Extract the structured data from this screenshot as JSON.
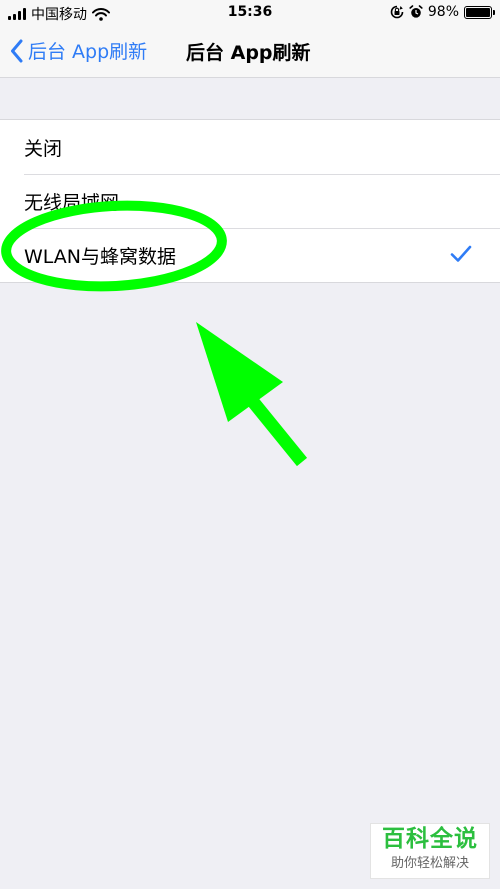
{
  "status_bar": {
    "carrier": "中国移动",
    "time": "15:36",
    "battery_percent": "98%",
    "battery_level": 0.98,
    "icons": [
      "signal-bars-icon",
      "wifi-icon",
      "orientation-lock-icon",
      "alarm-icon",
      "battery-icon"
    ]
  },
  "nav": {
    "back_label": "后台 App刷新",
    "title": "后台 App刷新",
    "accent": "#2f7cf6"
  },
  "options": [
    {
      "label": "关闭",
      "selected": false
    },
    {
      "label": "无线局域网",
      "selected": false
    },
    {
      "label": "WLAN与蜂窝数据",
      "selected": true
    }
  ],
  "annotation": {
    "color": "#00ff00",
    "shapes": [
      "ellipse-highlight",
      "arrow"
    ]
  },
  "watermark": {
    "brand": "百科全说",
    "tagline": "助你轻松解决"
  }
}
